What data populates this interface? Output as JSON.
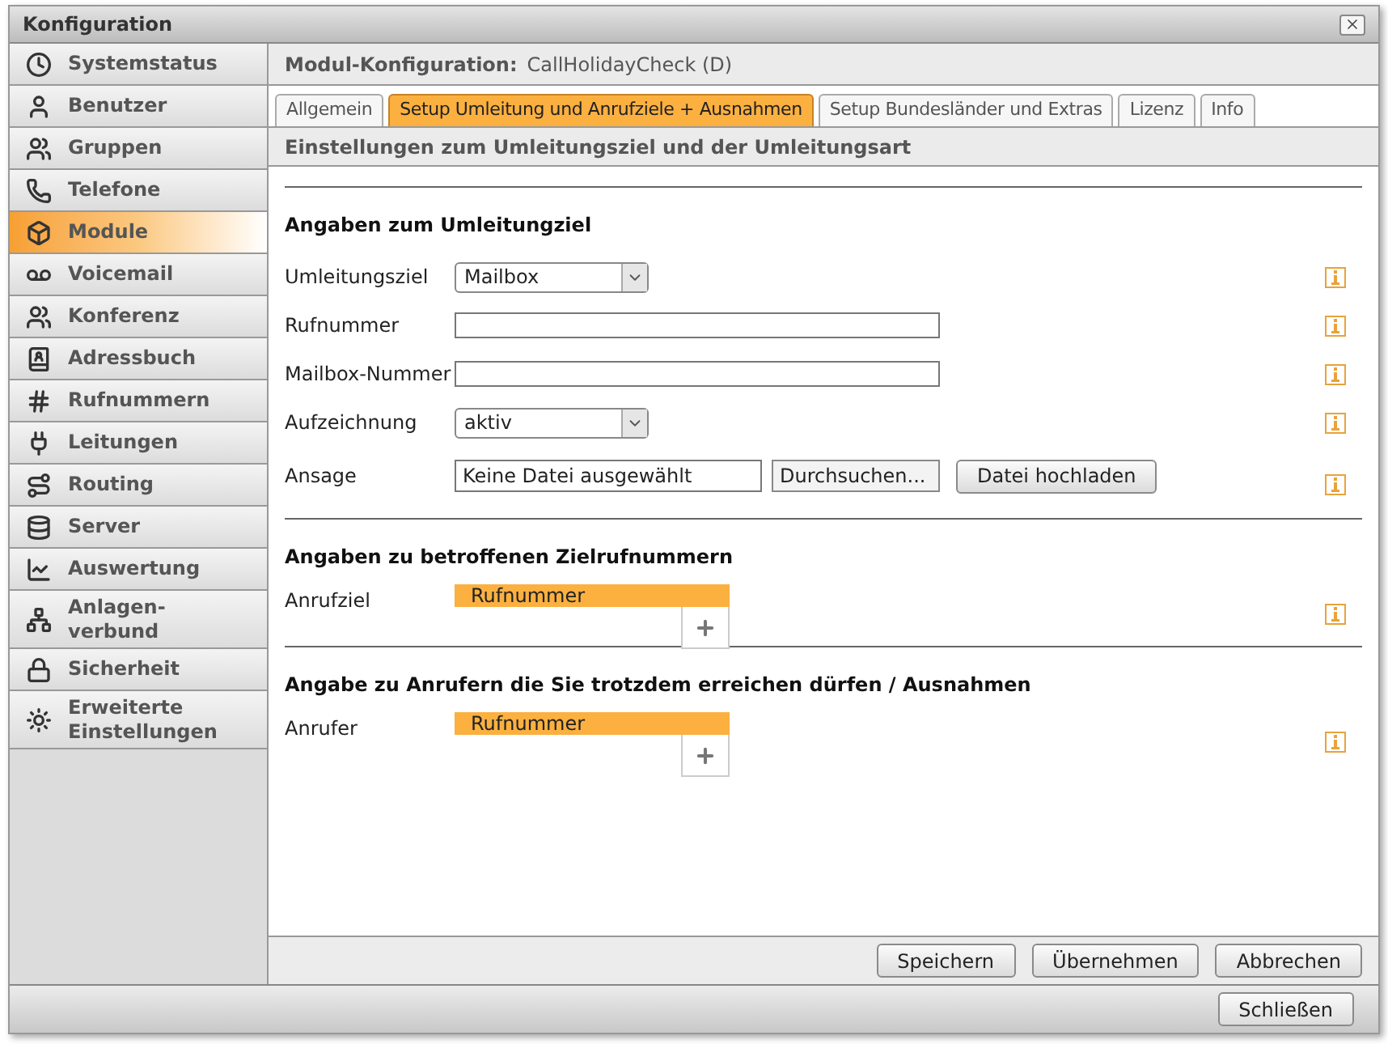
{
  "window": {
    "title": "Konfiguration"
  },
  "sidebar": {
    "items": [
      {
        "label": "Systemstatus",
        "selected": false
      },
      {
        "label": "Benutzer",
        "selected": false
      },
      {
        "label": "Gruppen",
        "selected": false
      },
      {
        "label": "Telefone",
        "selected": false
      },
      {
        "label": "Module",
        "selected": true
      },
      {
        "label": "Voicemail",
        "selected": false
      },
      {
        "label": "Konferenz",
        "selected": false
      },
      {
        "label": "Adressbuch",
        "selected": false
      },
      {
        "label": "Rufnummern",
        "selected": false
      },
      {
        "label": "Leitungen",
        "selected": false
      },
      {
        "label": "Routing",
        "selected": false
      },
      {
        "label": "Server",
        "selected": false
      },
      {
        "label": "Auswertung",
        "selected": false
      },
      {
        "label": "Anlagen-\nverbund",
        "selected": false
      },
      {
        "label": "Sicherheit",
        "selected": false
      },
      {
        "label": "Erweiterte\nEinstellungen",
        "selected": false
      }
    ]
  },
  "module_header": {
    "label": "Modul-Konfiguration:",
    "value": "CallHolidayCheck (D)"
  },
  "tabs": [
    {
      "label": "Allgemein",
      "selected": false
    },
    {
      "label": "Setup Umleitung und Anrufziele + Ausnahmen",
      "selected": true
    },
    {
      "label": "Setup Bundesländer und Extras",
      "selected": false
    },
    {
      "label": "Lizenz",
      "selected": false
    },
    {
      "label": "Info",
      "selected": false
    }
  ],
  "subheader": "Einstellungen zum Umleitungsziel und der Umleitungsart",
  "sections": [
    {
      "title": "Angaben zum Umleitungziel",
      "rows": [
        {
          "kind": "select",
          "label": "Umleitungsziel",
          "value": "Mailbox"
        },
        {
          "kind": "text",
          "label": "Rufnummer"
        },
        {
          "kind": "text",
          "label": "Mailbox-Nummer"
        },
        {
          "kind": "select",
          "label": "Aufzeichnung",
          "value": "aktiv"
        },
        {
          "kind": "file",
          "label": "Ansage",
          "value": "Keine Datei ausgewählt",
          "browse": "Durchsuchen...",
          "upload": "Datei hochladen"
        }
      ]
    },
    {
      "title": "Angaben zu betroffenen Zielrufnummern",
      "rows": [
        {
          "kind": "list",
          "label": "Anrufziel",
          "column": "Rufnummer"
        }
      ]
    },
    {
      "title": "Angabe zu Anrufern die Sie trotzdem erreichen dürfen / Ausnahmen",
      "rows": [
        {
          "kind": "list",
          "label": "Anrufer",
          "column": "Rufnummer"
        }
      ]
    }
  ],
  "footer_buttons": [
    "Speichern",
    "Übernehmen",
    "Abbrechen"
  ],
  "close_button": "Schließen"
}
